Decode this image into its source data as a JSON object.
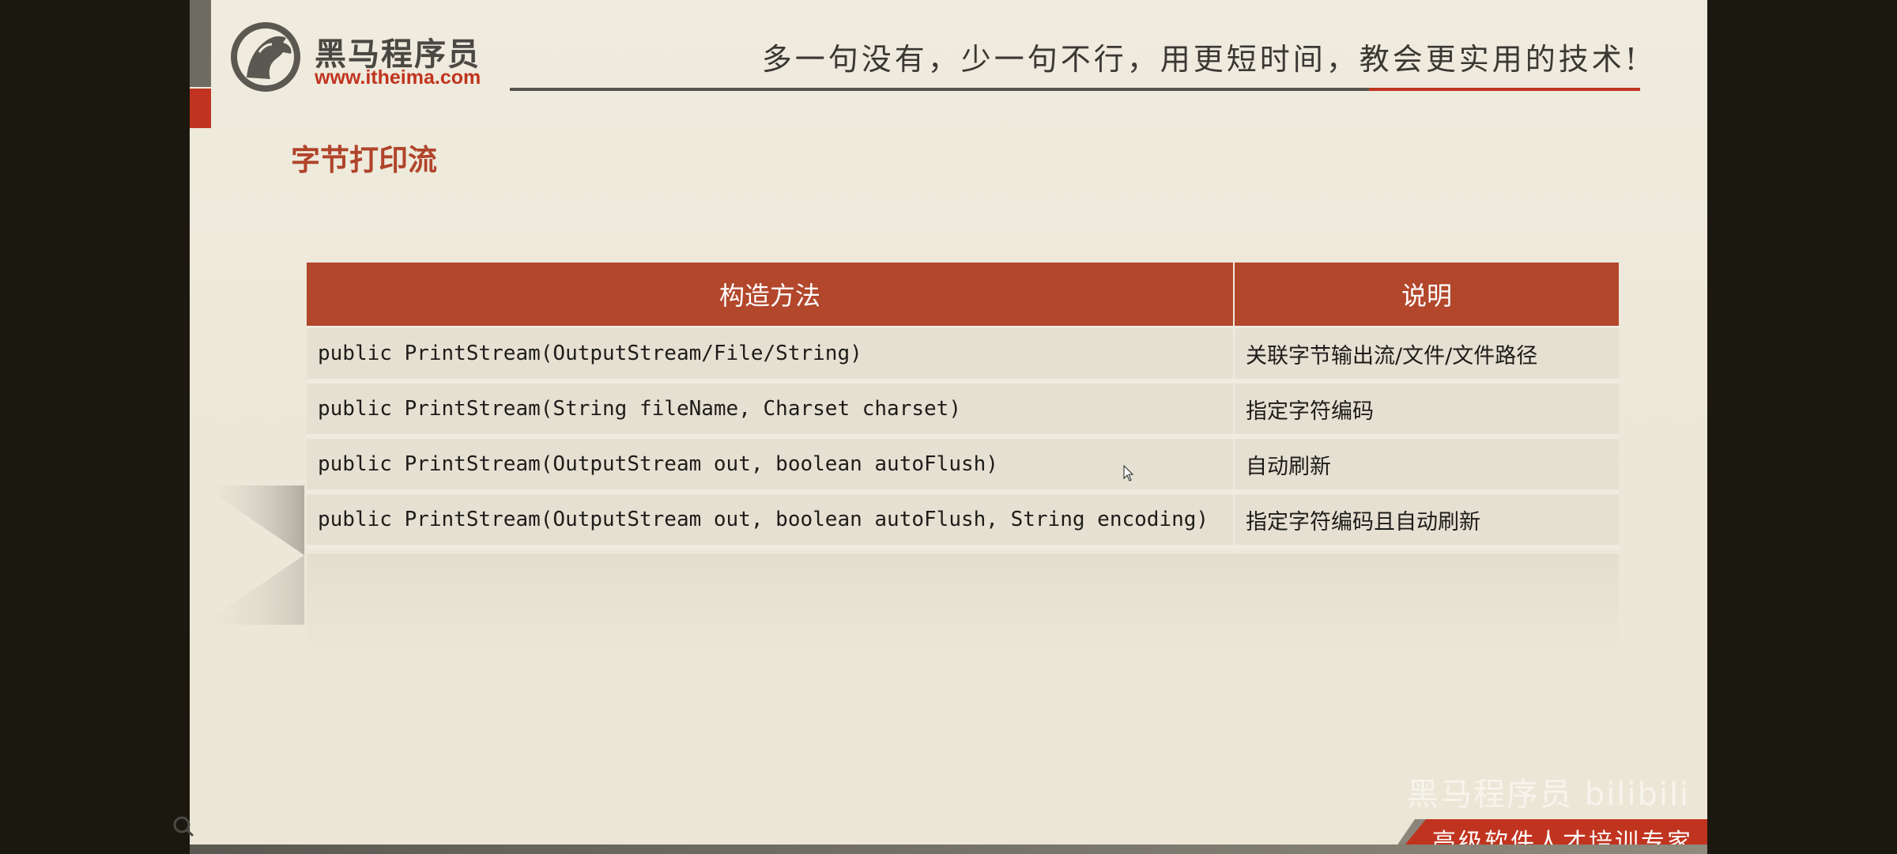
{
  "header": {
    "logo_name": "黑马程序员",
    "logo_url": "www.itheima.com",
    "slogan": "多一句没有，少一句不行，用更短时间，教会更实用的技术!"
  },
  "slide": {
    "title": "字节打印流"
  },
  "table": {
    "columns": [
      "构造方法",
      "说明"
    ],
    "rows": [
      {
        "method": "public PrintStream(OutputStream/File/String)",
        "desc": "关联字节输出流/文件/文件路径"
      },
      {
        "method": "public PrintStream(String fileName, Charset charset)",
        "desc": "指定字符编码"
      },
      {
        "method": "public PrintStream(OutputStream out, boolean autoFlush)",
        "desc": "自动刷新"
      },
      {
        "method": "public PrintStream(OutputStream out, boolean autoFlush, String encoding)",
        "desc": "指定字符编码且自动刷新"
      }
    ]
  },
  "footer": {
    "tagline": "高级软件人才培训专家",
    "watermark": "黑马程序员 bilibili"
  },
  "colors": {
    "accent": "#b2472b",
    "brand_red": "#c0341f",
    "slide_bg": "#efebde",
    "row_bg": "#e5e0d2"
  },
  "icons": {
    "logo": "horse-head-logo-icon",
    "cursor": "mouse-pointer-icon",
    "corner": "search-icon"
  }
}
